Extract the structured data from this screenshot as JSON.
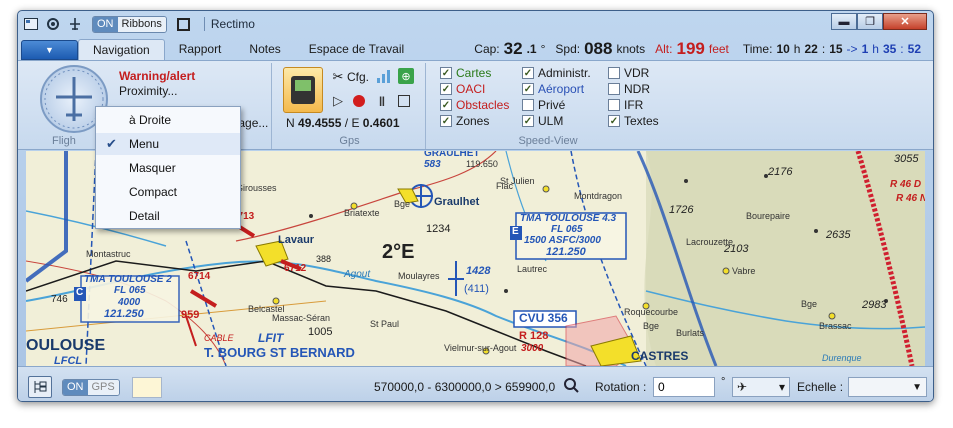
{
  "window": {
    "title": "Rectimo",
    "on_label": "ON",
    "ribbons_label": "Ribbons",
    "minimize": "▬",
    "maximize": "❐",
    "close": "✕"
  },
  "tabs": [
    "Navigation",
    "Rapport",
    "Notes",
    "Espace de Travail"
  ],
  "status": {
    "cap_label": "Cap:",
    "cap_value": "32",
    "cap_decimal": ".1",
    "cap_unit": "°",
    "spd_label": "Spd:",
    "spd_value": "088",
    "spd_unit": "knots",
    "alt_label": "Alt:",
    "alt_value": "199",
    "alt_unit": "feet",
    "time_label": "Time:",
    "time_h": "10",
    "time_h_unit": "h",
    "time_m": "22",
    "time_sep": ":",
    "time_s": "15",
    "arrow": "->",
    "eta_h": "1",
    "eta_h_unit": "h",
    "eta_m": "35",
    "eta_sep": ":",
    "eta_s": "52"
  },
  "ribbon": {
    "warning": "Warning/alert",
    "proximity": "Proximity...",
    "gazage": "gazage...",
    "flight_label": "Fligh",
    "gps_label": "Gps",
    "cfg_label": "Cfg.",
    "coord_n_label": "N",
    "coord_n": "49.4555",
    "coord_sep": "/",
    "coord_e_label": "E",
    "coord_e": "0.4601",
    "speedview_label": "Speed-View",
    "layers": [
      {
        "label": "Cartes",
        "checked": true,
        "color": "#2a7a19"
      },
      {
        "label": "OACI",
        "checked": true,
        "color": "#c41e1e"
      },
      {
        "label": "Obstacles",
        "checked": true,
        "color": "#c41e1e"
      },
      {
        "label": "Zones",
        "checked": true,
        "color": "#1a1a1a"
      }
    ],
    "types": [
      {
        "label": "Administr.",
        "checked": true,
        "color": "#1a1a1a"
      },
      {
        "label": "Aéroport",
        "checked": true,
        "color": "#2950b5"
      },
      {
        "label": "Privé",
        "checked": false,
        "color": "#1a1a1a"
      },
      {
        "label": "ULM",
        "checked": true,
        "color": "#1a1a1a"
      }
    ],
    "extras": [
      {
        "label": "VDR",
        "checked": false
      },
      {
        "label": "NDR",
        "checked": false
      },
      {
        "label": "IFR",
        "checked": false
      },
      {
        "label": "Textes",
        "checked": true
      }
    ]
  },
  "menu": {
    "items": [
      {
        "label": "à Droite",
        "checked": false
      },
      {
        "label": "Menu",
        "checked": true
      },
      {
        "label": "Masquer",
        "checked": false
      },
      {
        "label": "Compact",
        "checked": false
      },
      {
        "label": "Detail",
        "checked": false
      }
    ]
  },
  "map": {
    "labels": {
      "graulhet_top": "GRAULHET",
      "freq_583": "583",
      "freq_119": "119.650",
      "graulhet": "Graulhet",
      "elev_1234": "1234",
      "tma_toulouse43": "TMA TOULOUSE 4.3",
      "fl065a": "FL 065",
      "asfc": "1500 ASFC/3000",
      "freq_121a": "121.250",
      "zone_e": "E",
      "tma_toulouse2": "TMA TOULOUSE 2",
      "fl065b": "FL 065",
      "alt4000": "4000",
      "freq_121b": "121.250",
      "zone_c": "C",
      "deg2e": "2°E",
      "ndb_1428": "1428",
      "ndb_411": "(411)",
      "cvu": "CVU 356",
      "r128": "R 128",
      "r128_alt": "3000",
      "castres": "CASTRES",
      "bourg": "T. BOURG ST BERNARD",
      "lfit": "LFIT",
      "toulouse": "OULOUSE",
      "lfcl": "LFCL",
      "cable": "CABLE",
      "obs_6713": "6713",
      "obs_6712": "6712",
      "obs_6714": "6714",
      "obs_959": "959",
      "obs_388": "388",
      "elev_1005": "1005",
      "elev_1726": "1726",
      "elev_2176": "2176",
      "elev_2103": "2103",
      "elev_2635": "2635",
      "elev_2983": "2983",
      "elev_3055": "3055",
      "elev_746": "746",
      "r46d": "R 46 D",
      "r46n": "R 46 N",
      "lavaur": "Lavaur",
      "briatexte": "Briatexte",
      "girousses": "Girousses",
      "lautrec": "Lautrec",
      "vabre": "Vabre",
      "brassac": "Brassac",
      "roquecourbe": "Roquecourbe",
      "montdragon": "Montdragon",
      "fiac": "Fiac",
      "st_julien": "St Julien",
      "moulayres": "Moulayres",
      "belcastel": "Belcastel",
      "massac": "Massac-Séran",
      "st_paul": "St Paul",
      "vielmur": "Vielmur-sur-Agout",
      "agout": "Agout",
      "bge1": "Bge",
      "bge2": "Bge",
      "bge3": "Bge",
      "burlats": "Burlats",
      "lacrouzette": "Lacrouzette",
      "dourgne": "Durenque",
      "baurepaire": "Bourepaire",
      "montastruc": "Montastruc"
    }
  },
  "bottom": {
    "on_label": "ON",
    "gps_label": "GPS",
    "range": "570000,0 - 6300000,0 > 659900,0",
    "rotation_label": "Rotation :",
    "rotation_value": "0",
    "rotation_unit": "°",
    "echelle_label": "Echelle :",
    "echelle_value": ""
  }
}
